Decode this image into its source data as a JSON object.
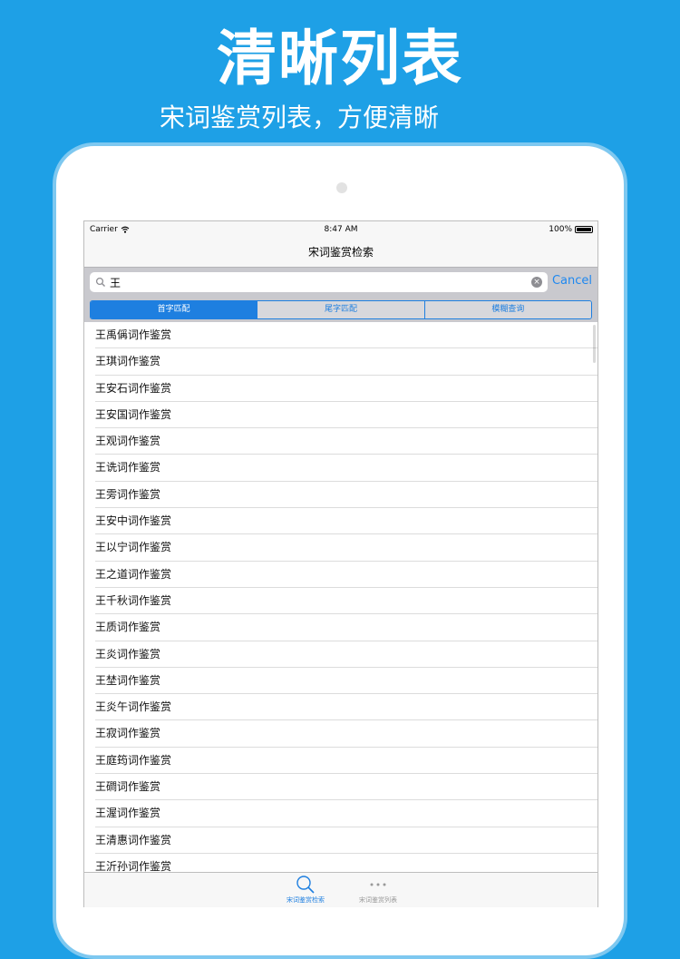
{
  "promo": {
    "title": "清晰列表",
    "subtitle": "宋词鉴赏列表，方便清晰"
  },
  "status_bar": {
    "carrier": "Carrier",
    "time": "8:47 AM",
    "battery": "100%",
    "battery_level": 1.0
  },
  "nav": {
    "title": "宋词鉴赏检索"
  },
  "search": {
    "value": "王",
    "cancel_label": "Cancel"
  },
  "scope": {
    "options": [
      "首字匹配",
      "尾字匹配",
      "模糊查询"
    ],
    "selected": "首字匹配"
  },
  "results": [
    "王禹偁词作鉴赏",
    "王琪词作鉴赏",
    "王安石词作鉴赏",
    "王安国词作鉴赏",
    "王观词作鉴赏",
    "王诜词作鉴赏",
    "王雱词作鉴赏",
    "王安中词作鉴赏",
    "王以宁词作鉴赏",
    "王之道词作鉴赏",
    "王千秋词作鉴赏",
    "王质词作鉴赏",
    "王炎词作鉴赏",
    "王埜词作鉴赏",
    "王炎午词作鉴赏",
    "王寂词作鉴赏",
    "王庭筠词作鉴赏",
    "王磵词作鉴赏",
    "王渥词作鉴赏",
    "王清惠词作鉴赏",
    "王沂孙词作鉴赏"
  ],
  "tabs": {
    "search_label": "宋词鉴赏检索",
    "list_label": "宋词鉴赏列表"
  },
  "colors": {
    "background": "#1EA0E6",
    "accent": "#1E7FE0"
  }
}
